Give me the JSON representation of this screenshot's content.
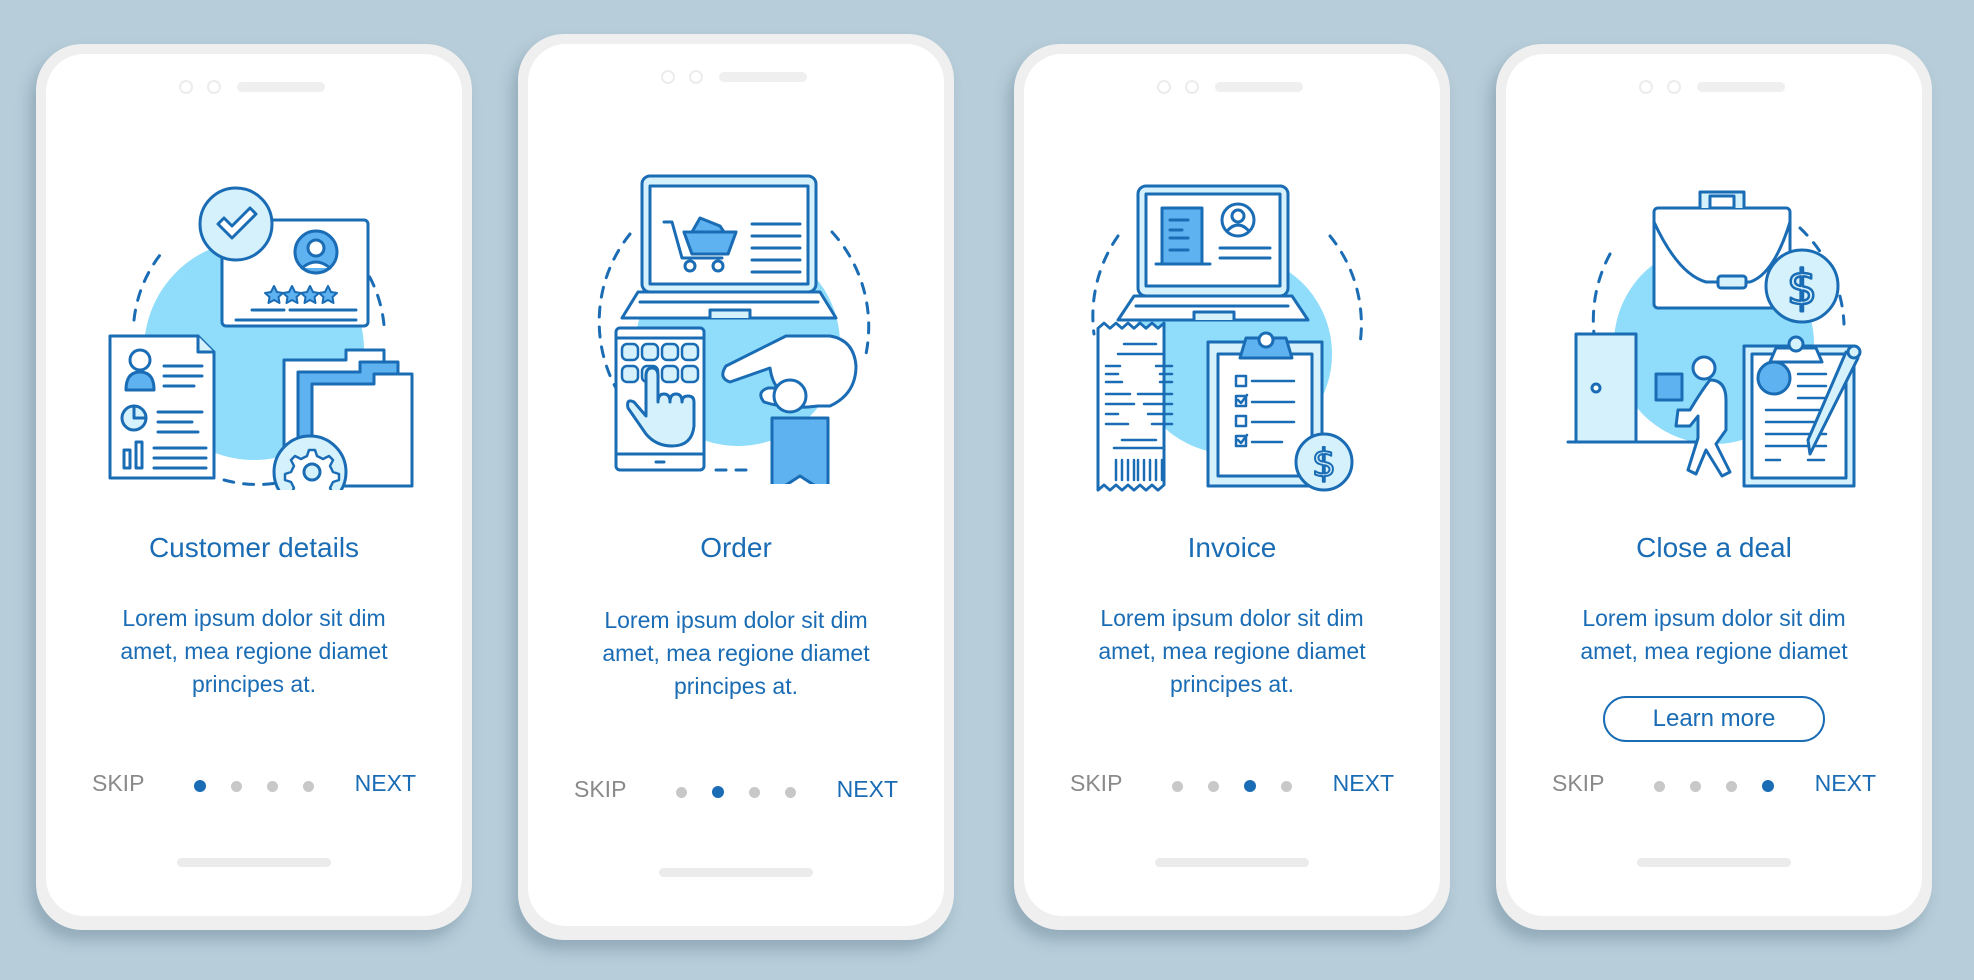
{
  "theme": {
    "primary": "#1a6cb4",
    "light": "#d4f1fc",
    "mid": "#8fdcfb",
    "fill": "#5eb2f0",
    "muted": "#8a8a8a",
    "background": "#b7cdd9"
  },
  "screens": [
    {
      "title": "Customer details",
      "illustration": "customer-details-illustration",
      "description": [
        "Lorem ipsum dolor sit dim",
        "amet, mea regione diamet",
        "principes at."
      ],
      "skip": "SKIP",
      "next": "NEXT",
      "page_index": 1,
      "page_count": 4
    },
    {
      "title": "Order",
      "illustration": "order-illustration",
      "description": [
        "Lorem ipsum dolor sit dim",
        "amet, mea regione diamet",
        "principes at."
      ],
      "skip": "SKIP",
      "next": "NEXT",
      "page_index": 2,
      "page_count": 4
    },
    {
      "title": "Invoice",
      "illustration": "invoice-illustration",
      "description": [
        "Lorem ipsum dolor sit dim",
        "amet, mea regione diamet",
        "principes at."
      ],
      "skip": "SKIP",
      "next": "NEXT",
      "page_index": 3,
      "page_count": 4
    },
    {
      "title": "Close a deal",
      "illustration": "close-deal-illustration",
      "description": [
        "Lorem ipsum dolor sit dim",
        "amet, mea regione diamet"
      ],
      "button": "Learn more",
      "skip": "SKIP",
      "next": "NEXT",
      "page_index": 4,
      "page_count": 4
    }
  ]
}
